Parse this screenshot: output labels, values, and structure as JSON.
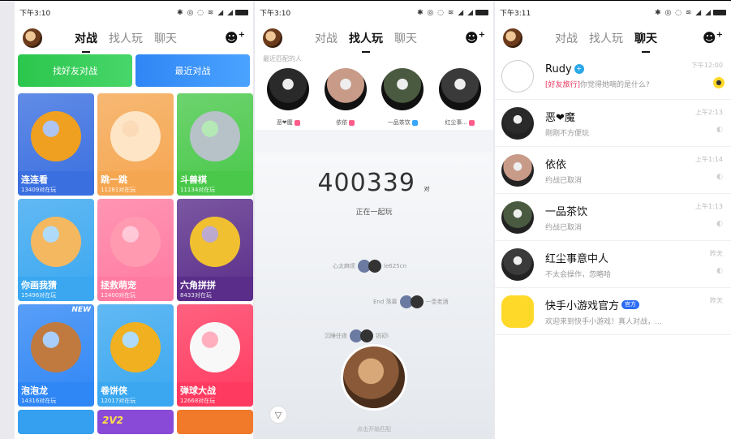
{
  "status": {
    "p1_time": "下午3:10",
    "p2_time": "下午3:10",
    "p3_time": "下午3:11",
    "icons": "✱ ◎ ◌ ≋ ◢ ◢"
  },
  "nav": {
    "tabs": [
      "对战",
      "找人玩",
      "聊天"
    ],
    "add_friend_icon": "add-user-icon"
  },
  "games_page": {
    "buttons": {
      "find_friends": "找好友对战",
      "recent_battles": "最近对战"
    },
    "games": [
      {
        "name": "连连看",
        "count": "13409对在玩",
        "color": "#3a6fe0",
        "art": "#f0a020"
      },
      {
        "name": "跳一跳",
        "count": "11281对在玩",
        "color": "#f5a650",
        "art": "#fde5c6"
      },
      {
        "name": "斗兽棋",
        "count": "11134对在玩",
        "color": "#49c84a",
        "art": "#b6c2c8"
      },
      {
        "name": "你画我猜",
        "count": "15496对在玩",
        "color": "#3aa7f0",
        "art": "#f4b860"
      },
      {
        "name": "拯救萌宠",
        "count": "12400对在玩",
        "color": "#ff7aa0",
        "art": "#ff9ab0"
      },
      {
        "name": "六角拼拼",
        "count": "8433对在玩",
        "color": "#5a2d8a",
        "art": "#f0c030"
      },
      {
        "name": "泡泡龙",
        "count": "14316对在玩",
        "color": "#2f86f5",
        "art": "#c07a40",
        "badge": "NEW"
      },
      {
        "name": "卷饼侠",
        "count": "12017对在玩",
        "color": "#3aa7f0",
        "art": "#f0b020"
      },
      {
        "name": "弹球大战",
        "count": "12668对在玩",
        "color": "#ff3a60",
        "art": "#f8f8f8"
      }
    ],
    "partial_tiles": [
      {
        "color": "#35a0f0"
      },
      {
        "color": "#8a4ad8",
        "text": "2V2"
      },
      {
        "color": "#f07a2a"
      }
    ]
  },
  "find_page": {
    "recent_label": "最近匹配的人",
    "recent_matches": [
      {
        "name": "恶❤魔",
        "gender": "f",
        "tone": "#2a2a2a"
      },
      {
        "name": "依依",
        "gender": "f",
        "tone": "#c89a88"
      },
      {
        "name": "一品茶饮",
        "gender": "m",
        "tone": "#4a5a40"
      },
      {
        "name": "红尘事...",
        "gender": "f",
        "tone": "#3a3a3a"
      }
    ],
    "online_count": "400339",
    "online_unit": "对",
    "together_text": "正在一起玩",
    "pairs": [
      {
        "left": "心太麻烦",
        "right": "le625cn"
      },
      {
        "left": "End 落幕",
        "right": "一壶老酒"
      },
      {
        "left": "沉睡往夜",
        "right": "锐初i"
      }
    ],
    "filter_icon": "filter-icon",
    "start_hint": "点击开始匹配"
  },
  "chat_page": {
    "chats": [
      {
        "name": "Rudy",
        "badge": "verified",
        "tag": "[好友旅行]",
        "message": "你觉得她嘀的是什么?",
        "time": "下午12:00",
        "status": "unread",
        "avatar": "#f4f4f4"
      },
      {
        "name": "恶❤魔",
        "message": "刚刚不方便玩",
        "time": "上午2:13",
        "status": "read",
        "avatar": "#2a2a2a"
      },
      {
        "name": "依依",
        "message": "约战已取消",
        "time": "上午1:14",
        "status": "read",
        "avatar": "#c89a88"
      },
      {
        "name": "一品茶饮",
        "message": "约战已取消",
        "time": "上午1:13",
        "status": "read",
        "avatar": "#4a5a40"
      },
      {
        "name": "红尘事意中人",
        "message": "不太会操作，忽略哈",
        "time": "昨天",
        "status": "read",
        "avatar": "#3a3a3a"
      },
      {
        "name": "快手小游戏官方",
        "official": "官方",
        "message": "欢迎来到快手小游戏！真人对战，...",
        "time": "昨天",
        "avatar": "#ffd92a"
      }
    ]
  }
}
